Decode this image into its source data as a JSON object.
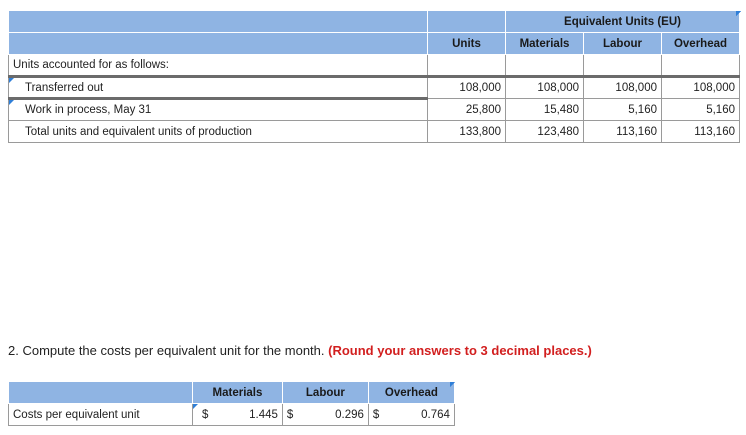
{
  "eu_table": {
    "group_header": "Equivalent Units (EU)",
    "columns": [
      "Units",
      "Materials",
      "Labour",
      "Overhead"
    ],
    "section_label": "Units accounted for as follows:",
    "rows": [
      {
        "label": "Transferred out",
        "values": [
          "108,000",
          "108,000",
          "108,000",
          "108,000"
        ]
      },
      {
        "label": "Work in process, May 31",
        "values": [
          "25,800",
          "15,480",
          "5,160",
          "5,160"
        ]
      },
      {
        "label": "Total units and equivalent units of production",
        "values": [
          "133,800",
          "123,480",
          "113,160",
          "113,160"
        ]
      }
    ]
  },
  "instruction": {
    "text": "2. Compute the costs per equivalent unit for the month.",
    "emphasis": "(Round your answers to 3 decimal places.)"
  },
  "cost_table": {
    "columns": [
      "Materials",
      "Labour",
      "Overhead"
    ],
    "row_label": "Costs per equivalent unit",
    "currency": "$",
    "values": [
      "1.445",
      "0.296",
      "0.764"
    ]
  },
  "colors": {
    "header_bg": "#8fb4e3",
    "input_marker": "#2f7fd8",
    "emphasis": "#d21f1f"
  }
}
